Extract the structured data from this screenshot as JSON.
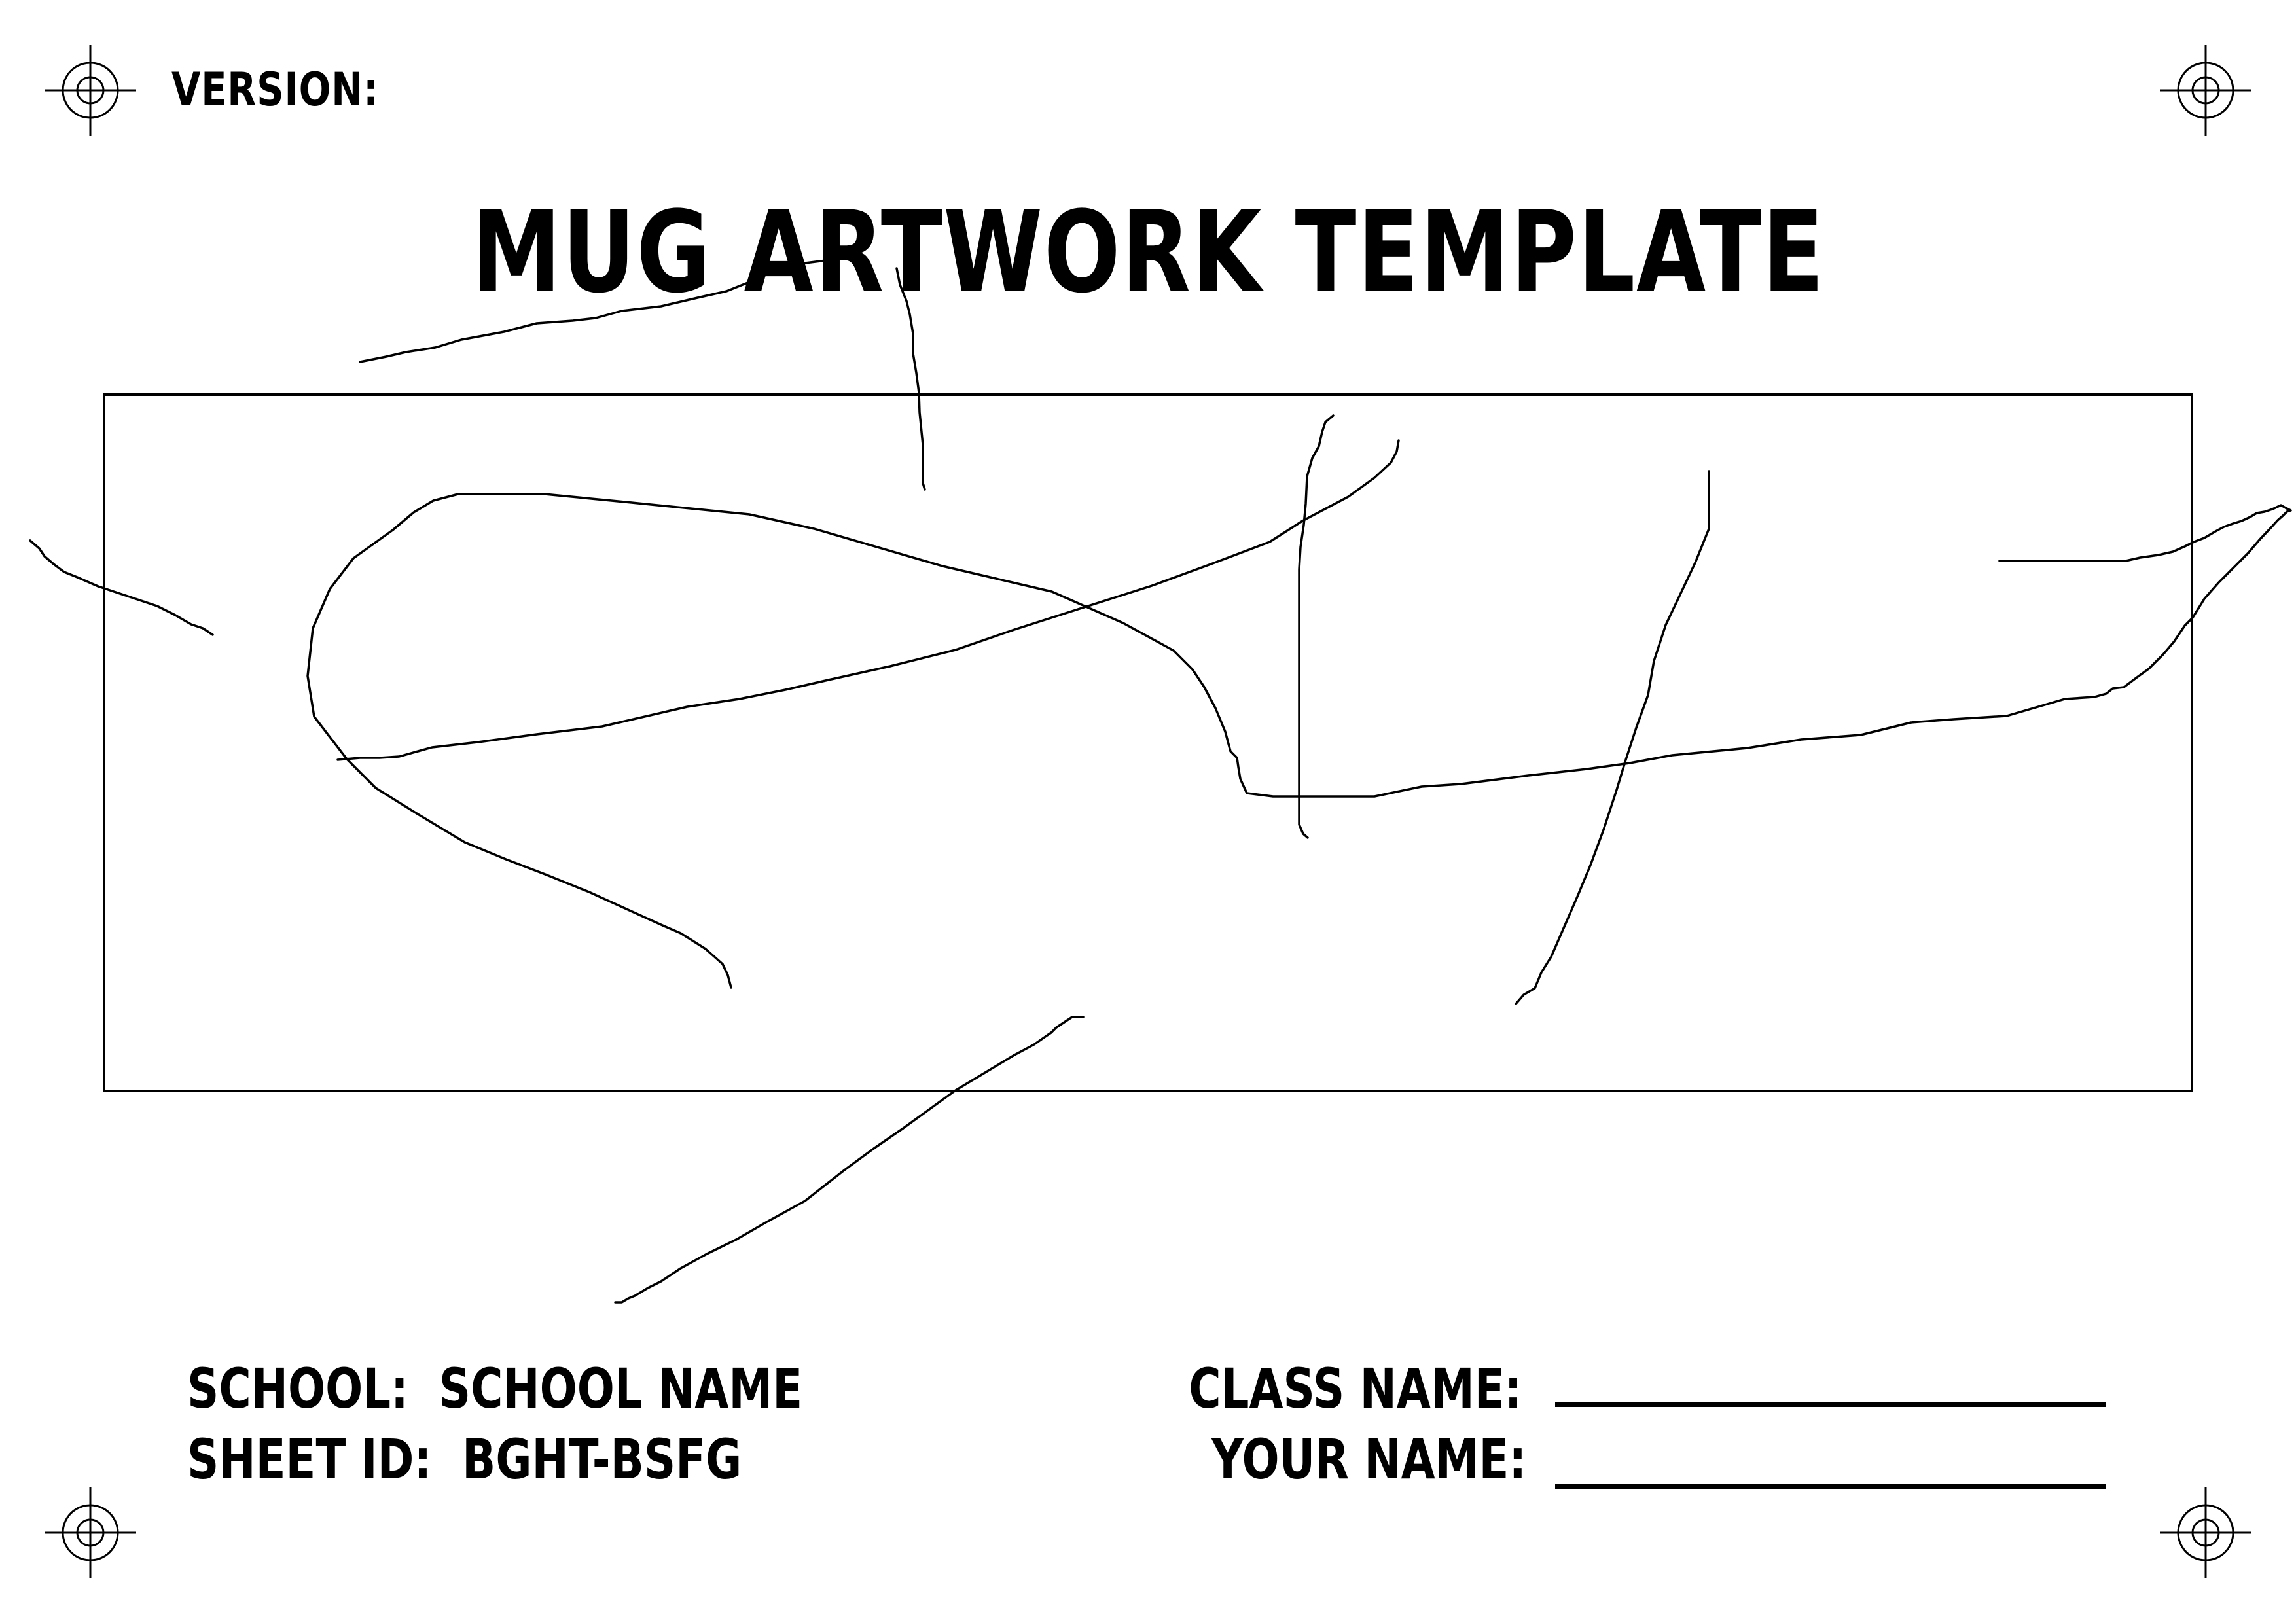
{
  "header": {
    "version_label": "VERSION:"
  },
  "title": "MUG ARTWORK TEMPLATE",
  "footer": {
    "school_label": "SCHOOL:",
    "school_value": "SCHOOL NAME",
    "sheet_id_label": "SHEET ID:",
    "sheet_id_value": "BGHT-BSFG",
    "class_name_label": "CLASS NAME:",
    "class_name_value": "",
    "your_name_label": "YOUR NAME:",
    "your_name_value": ""
  },
  "registration_marks": [
    "top-left",
    "top-right",
    "bottom-left",
    "bottom-right"
  ],
  "colors": {
    "ink": "#000000",
    "paper": "#ffffff"
  }
}
